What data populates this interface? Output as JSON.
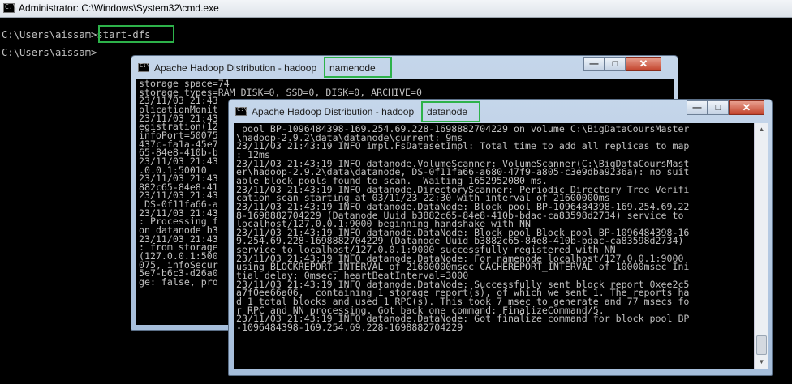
{
  "main_window": {
    "title": "Administrator: C:\\Windows\\System32\\cmd.exe",
    "icon": "cmd-icon",
    "console_lines": [
      "C:\\Users\\aissam>start-dfs",
      "C:\\Users\\aissam>"
    ]
  },
  "namenode_window": {
    "title_prefix": "Apache Hadoop Distribution - hadoop",
    "title_suffix": "namenode",
    "icon": "cmd-icon",
    "controls": {
      "minimize": "—",
      "maximize": "□",
      "close": "✕"
    },
    "lines": [
      "storage space=74",
      "storage types=RAM DISK=0, SSD=0, DISK=0, ARCHIVE=0",
      "23/11/03 21:43",
      "plicationMonit",
      "23/11/03 21:43",
      "egistration(12",
      "infoPort=50075",
      "437c-fa1a-45e7",
      "65-84e8-410b-b",
      "23/11/03 21:43",
      ".0.0.1:50010",
      "23/11/03 21:43",
      "882c65-84e8-41",
      "23/11/03 21:43",
      " DS-0f11fa66-a",
      "23/11/03 21:43",
      ": Processing f",
      "on datanode b3",
      "23/11/03 21:43",
      ": from storage",
      "(127.0.0.1:500",
      "075, infoSecur",
      "5e7-b6c3-d26a0",
      "ge: false, pro"
    ]
  },
  "datanode_window": {
    "title_prefix": "Apache Hadoop Distribution - hadoop",
    "title_suffix": "datanode",
    "icon": "cmd-icon",
    "controls": {
      "minimize": "—",
      "maximize": "□",
      "close": "✕"
    },
    "lines": [
      " pool BP-1096484398-169.254.69.228-1698882704229 on volume C:\\BigDataCoursMaster",
      "\\hadoop-2.9.2\\data\\datanode\\current: 9ms",
      "23/11/03 21:43:19 INFO impl.FsDatasetImpl: Total time to add all replicas to map",
      ": 12ms",
      "23/11/03 21:43:19 INFO datanode.VolumeScanner: VolumeScanner(C:\\BigDataCoursMast",
      "er\\hadoop-2.9.2\\data\\datanode, DS-0f11fa66-a680-47f9-a805-c3e9dba9236a): no suit",
      "able block pools found to scan.  Waiting 1652952080 ms.",
      "23/11/03 21:43:19 INFO datanode.DirectoryScanner: Periodic Directory Tree Verifi",
      "cation scan starting at 03/11/23 22:30 with interval of 21600000ms",
      "23/11/03 21:43:19 INFO datanode.DataNode: Block pool BP-1096484398-169.254.69.22",
      "8-1698882704229 (Datanode Uuid b3882c65-84e8-410b-bdac-ca83598d2734) service to",
      "localhost/127.0.0.1:9000 beginning handshake with NN",
      "23/11/03 21:43:19 INFO datanode.DataNode: Block pool Block pool BP-1096484398-16",
      "9.254.69.228-1698882704229 (Datanode Uuid b3882c65-84e8-410b-bdac-ca83598d2734)",
      "service to localhost/127.0.0.1:9000 successfully registered with NN",
      "23/11/03 21:43:19 INFO datanode.DataNode: For namenode localhost/127.0.0.1:9000",
      "using BLOCKREPORT_INTERVAL of 21600000msec CACHEREPORT_INTERVAL of 10000msec Ini",
      "tial delay: 0msec; heartBeatInterval=3000",
      "23/11/03 21:43:19 INFO datanode.DataNode: Successfully sent block report 0xee2c5",
      "a7f0ee66a06,  containing 1 storage report(s), of which we sent 1. The reports ha",
      "d 1 total blocks and used 1 RPC(s). This took 7 msec to generate and 77 msecs fo",
      "r RPC and NN processing. Got back one command: FinalizeCommand/5.",
      "23/11/03 21:43:19 INFO datanode.DataNode: Got finalize command for block pool BP",
      "-1096484398-169.254.69.228-1698882704229"
    ]
  },
  "colors": {
    "highlight": "#2db24a",
    "console_text": "#c0c0c0",
    "console_bg": "#000000"
  }
}
